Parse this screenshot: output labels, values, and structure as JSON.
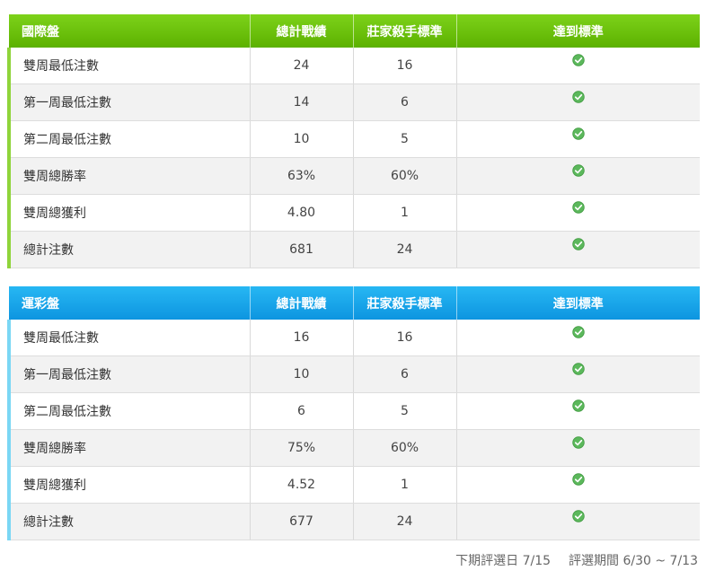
{
  "tables": [
    {
      "id": "intl",
      "header": {
        "title": "國際盤",
        "col_total": "總計戰績",
        "col_standard": "莊家殺手標準",
        "col_met": "達到標準"
      },
      "rows": [
        {
          "label": "雙周最低注數",
          "total": "24",
          "standard": "16",
          "met": "check-circle-icon"
        },
        {
          "label": "第一周最低注數",
          "total": "14",
          "standard": "6",
          "met": "check-circle-icon"
        },
        {
          "label": "第二周最低注數",
          "total": "10",
          "standard": "5",
          "met": "check-circle-icon"
        },
        {
          "label": "雙周總勝率",
          "total": "63%",
          "standard": "60%",
          "met": "check-circle-icon"
        },
        {
          "label": "雙周總獲利",
          "total": "4.80",
          "standard": "1",
          "met": "check-circle-icon"
        },
        {
          "label": "總計注數",
          "total": "681",
          "standard": "24",
          "met": "check-circle-icon"
        }
      ]
    },
    {
      "id": "sports",
      "header": {
        "title": "運彩盤",
        "col_total": "總計戰績",
        "col_standard": "莊家殺手標準",
        "col_met": "達到標準"
      },
      "rows": [
        {
          "label": "雙周最低注數",
          "total": "16",
          "standard": "16",
          "met": "check-circle-icon"
        },
        {
          "label": "第一周最低注數",
          "total": "10",
          "standard": "6",
          "met": "check-circle-icon"
        },
        {
          "label": "第二周最低注數",
          "total": "6",
          "standard": "5",
          "met": "check-circle-icon"
        },
        {
          "label": "雙周總勝率",
          "total": "75%",
          "standard": "60%",
          "met": "check-circle-icon"
        },
        {
          "label": "雙周總獲利",
          "total": "4.52",
          "standard": "1",
          "met": "check-circle-icon"
        },
        {
          "label": "總計注數",
          "total": "677",
          "standard": "24",
          "met": "check-circle-icon"
        }
      ]
    }
  ],
  "footer": {
    "next_selection": "下期評選日 7/15",
    "selection_period": "評選期間 6/30 ~ 7/13"
  },
  "colors": {
    "intl_header": "#5cb100",
    "sports_header": "#0d95e0",
    "check": "#5cb85c"
  }
}
